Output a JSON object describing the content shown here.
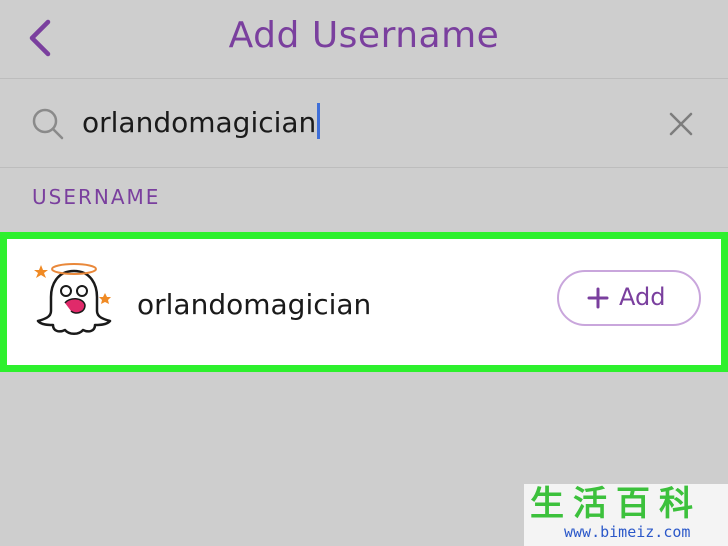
{
  "header": {
    "back_icon": "chevron-left-icon",
    "title": "Add Username"
  },
  "search": {
    "icon": "search-icon",
    "query": "orlandomagician",
    "clear_icon": "close-icon"
  },
  "results": {
    "section_label": "USERNAME",
    "items": [
      {
        "avatar_icon": "ghost-avatar-icon",
        "username": "orlandomagician",
        "add_label": "Add"
      }
    ]
  },
  "colors": {
    "accent": "#7a3f9e",
    "highlight": "#2df02d",
    "background": "#cecece",
    "caret": "#3f6fd8"
  },
  "watermark": {
    "chars": "生活百科",
    "url": "www.bimeiz.com"
  }
}
